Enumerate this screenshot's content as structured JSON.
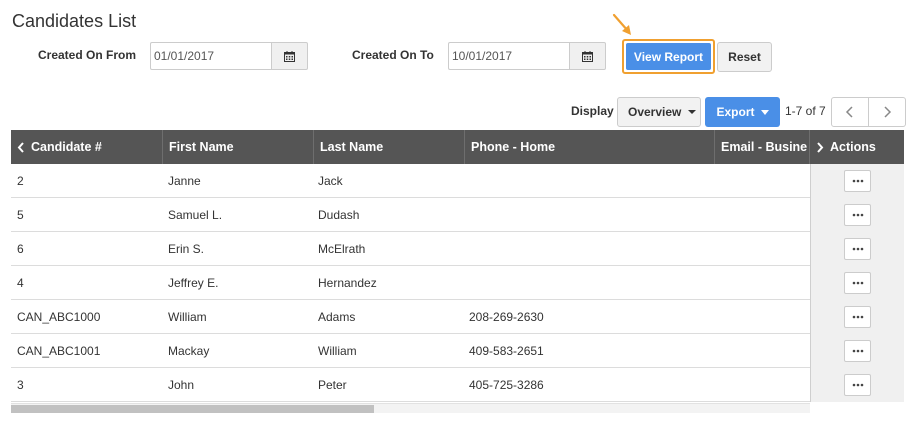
{
  "page": {
    "title": "Candidates List"
  },
  "filters": {
    "from_label": "Created On From",
    "from_value": "01/01/2017",
    "to_label": "Created On To",
    "to_value": "10/01/2017",
    "view_report_label": "View Report",
    "reset_label": "Reset"
  },
  "toolbar": {
    "display_label": "Display",
    "display_value": "Overview",
    "export_label": "Export",
    "pager_text": "1-7 of 7"
  },
  "colors": {
    "primary": "#4a8fe7",
    "highlight": "#f0a030",
    "header_bg": "#555555"
  },
  "table": {
    "columns": [
      "Candidate #",
      "First Name",
      "Last Name",
      "Phone - Home",
      "Email - Busine",
      "Actions"
    ],
    "rows": [
      [
        "2",
        "Janne",
        "Jack",
        ""
      ],
      [
        "5",
        "Samuel L.",
        "Dudash",
        ""
      ],
      [
        "6",
        "Erin S.",
        "McElrath",
        ""
      ],
      [
        "4",
        "Jeffrey E.",
        "Hernandez",
        ""
      ],
      [
        "CAN_ABC1000",
        "William",
        "Adams",
        "208-269-2630"
      ],
      [
        "CAN_ABC1001",
        "Mackay",
        "William",
        "409-583-2651"
      ],
      [
        "3",
        "John",
        "Peter",
        "405-725-3286"
      ]
    ]
  }
}
